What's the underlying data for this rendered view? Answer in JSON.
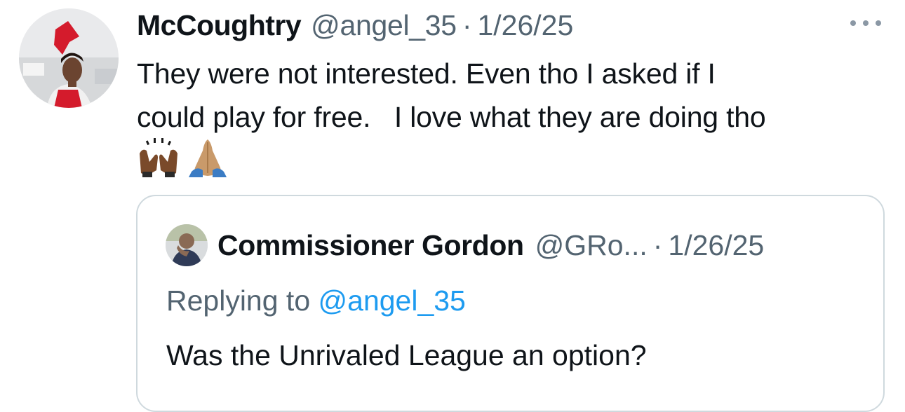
{
  "tweet": {
    "display_name": "McCoughtry",
    "handle": "@angel_35",
    "separator": "·",
    "date": "1/26/25",
    "more_icon": "more-horizontal-icon",
    "text": "They were not interested. Even tho I asked if I\ncould play for free.   I love what they are doing tho",
    "emojis": [
      "raising-hands-emoji",
      "folded-hands-emoji"
    ]
  },
  "quoted_tweet": {
    "display_name": "Commissioner Gordon",
    "handle": "@GRo...",
    "separator": "·",
    "date": "1/26/25",
    "replying_prefix": "Replying to ",
    "replying_handle": "@angel_35",
    "text": "Was the Unrivaled League an option?"
  },
  "colors": {
    "text_primary": "#0f1419",
    "text_secondary": "#536471",
    "link": "#1d9bf0",
    "border": "#cfd9de",
    "accent_red": "#d41b2c"
  }
}
